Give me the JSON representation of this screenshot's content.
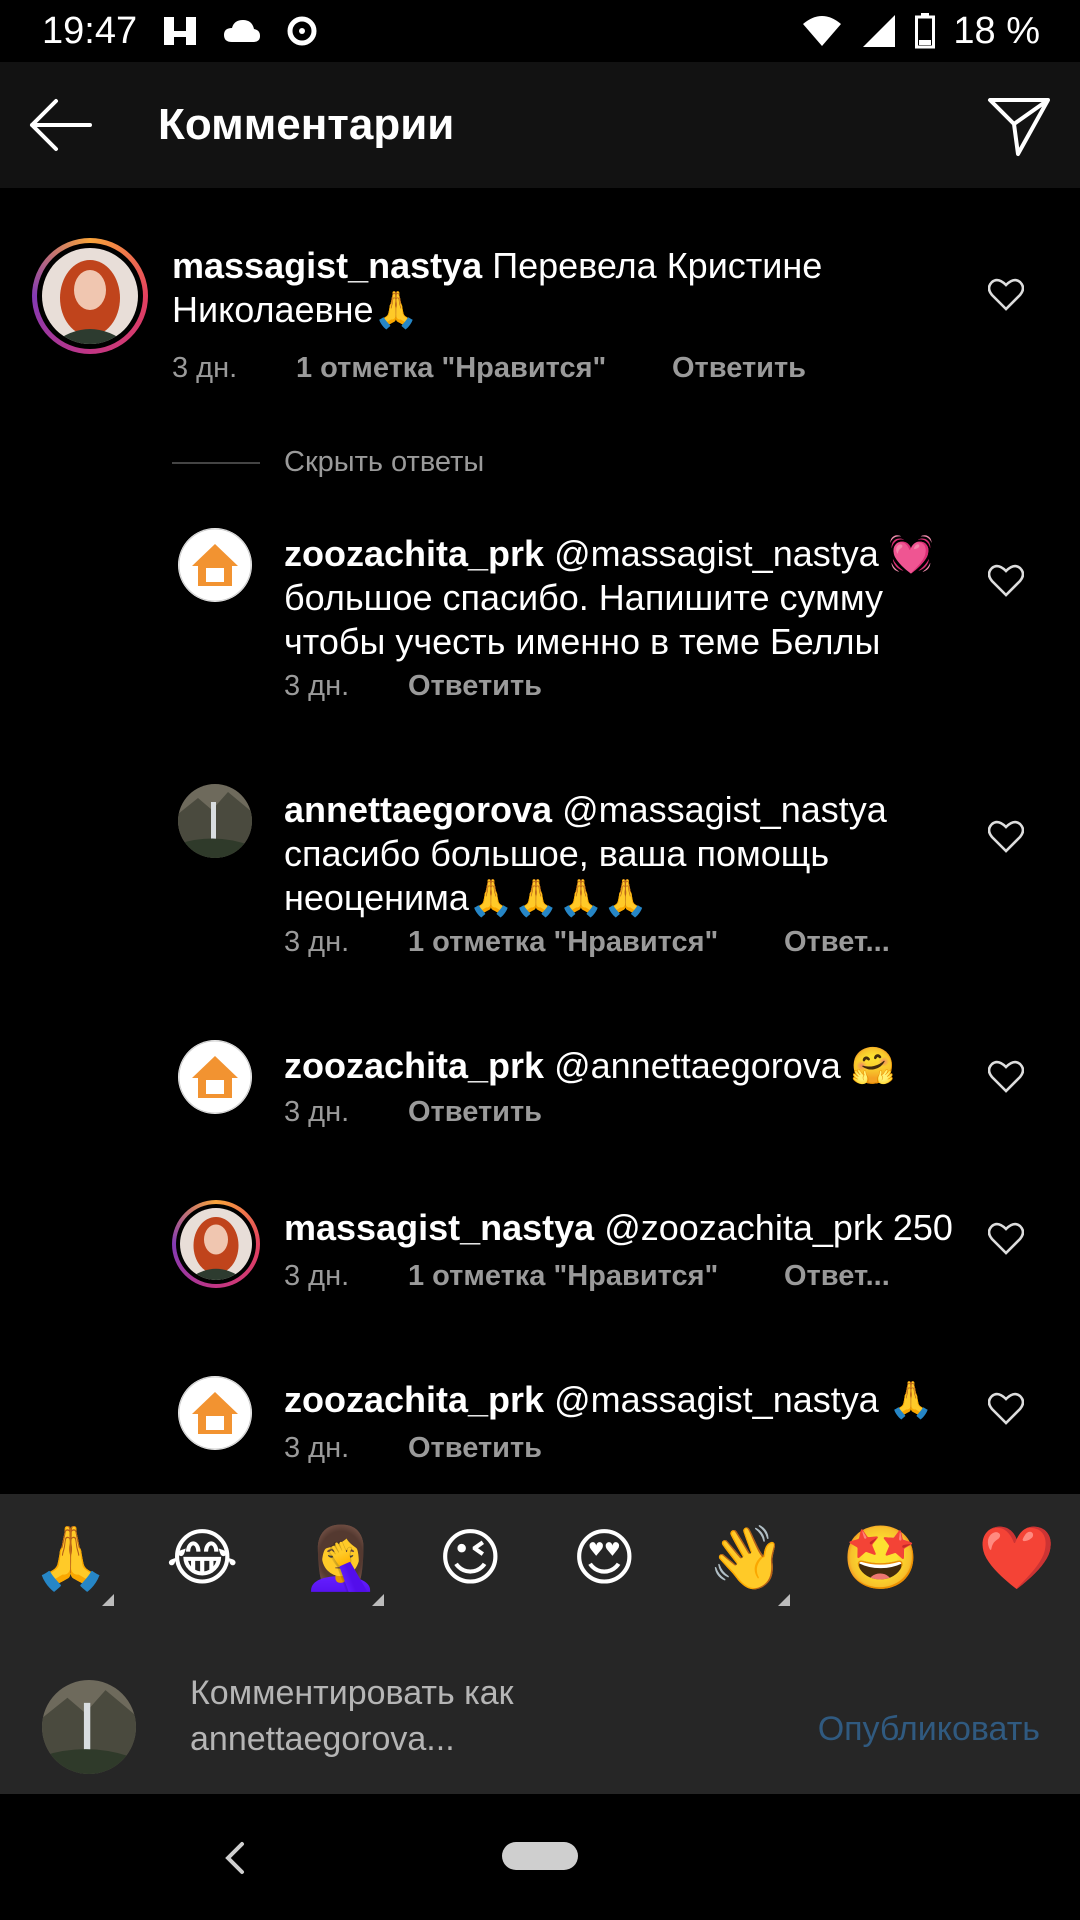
{
  "status_bar": {
    "time": "19:47",
    "battery": "18 %"
  },
  "app_bar": {
    "title": "Комментарии"
  },
  "main_comment": {
    "username": "massagist_nastya",
    "text": " Перевела Кристине Николаевне🙏",
    "age": "3 дн.",
    "likes": "1 отметка \"Нравится\"",
    "reply": "Ответить"
  },
  "hide_replies": "Скрыть ответы",
  "replies": [
    {
      "username": "zoozachita_prk",
      "text": " @massagist_nastya 💓 большое спасибо. Напишите сумму чтобы учесть именно в теме Беллы",
      "age": "3 дн.",
      "likes": "",
      "reply": "Ответить"
    },
    {
      "username": "annettaegorova",
      "text": " @massagist_nastya спасибо большое, ваша помощь неоценима🙏🙏🙏🙏",
      "age": "3 дн.",
      "likes": "1 отметка \"Нравится\"",
      "reply": "Ответ..."
    },
    {
      "username": "zoozachita_prk",
      "text": " @annettaegorova 🤗",
      "age": "3 дн.",
      "likes": "",
      "reply": "Ответить"
    },
    {
      "username": "massagist_nastya",
      "text": " @zoozachita_prk 250",
      "age": "3 дн.",
      "likes": "1 отметка \"Нравится\"",
      "reply": "Ответ..."
    },
    {
      "username": "zoozachita_prk",
      "text": " @massagist_nastya 🙏",
      "age": "3 дн.",
      "likes": "",
      "reply": "Ответить"
    }
  ],
  "emoji_bar": [
    "🙏",
    "😂",
    "🤦‍♀️",
    "😉",
    "😍",
    "👋",
    "🤩",
    "❤️"
  ],
  "composer": {
    "placeholder": "Комментировать как annettaegorova...",
    "post_label": "Опубликовать"
  },
  "colors": {
    "post_disabled": "#305a80",
    "meta": "#9a9a9a",
    "appbar": "#121212"
  }
}
